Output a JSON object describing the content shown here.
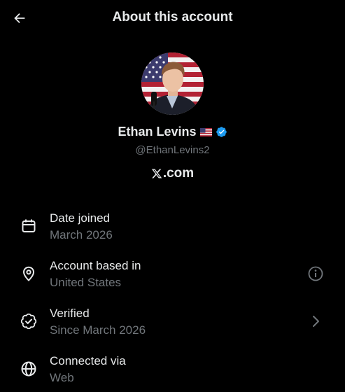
{
  "header": {
    "title": "About this account"
  },
  "profile": {
    "display_name": "Ethan Levins",
    "handle": "@EthanLevins2",
    "flag_icon": "us-flag-icon",
    "verified_icon": "verified-badge-icon",
    "verified_color": "#1d9bf0",
    "site_label": ".com",
    "site_logo": "x-logo-icon"
  },
  "details": [
    {
      "icon": "calendar-icon",
      "title": "Date joined",
      "value": "March 2026"
    },
    {
      "icon": "location-pin-icon",
      "title": "Account based in",
      "value": "United States",
      "action_icon": "info-icon"
    },
    {
      "icon": "verified-outline-icon",
      "title": "Verified",
      "value": "Since March 2026",
      "action_icon": "chevron-right-icon"
    },
    {
      "icon": "globe-icon",
      "title": "Connected via",
      "value": "Web"
    }
  ],
  "colors": {
    "background": "#000000",
    "primary_text": "#e7e9ea",
    "secondary_text": "#71767b"
  }
}
